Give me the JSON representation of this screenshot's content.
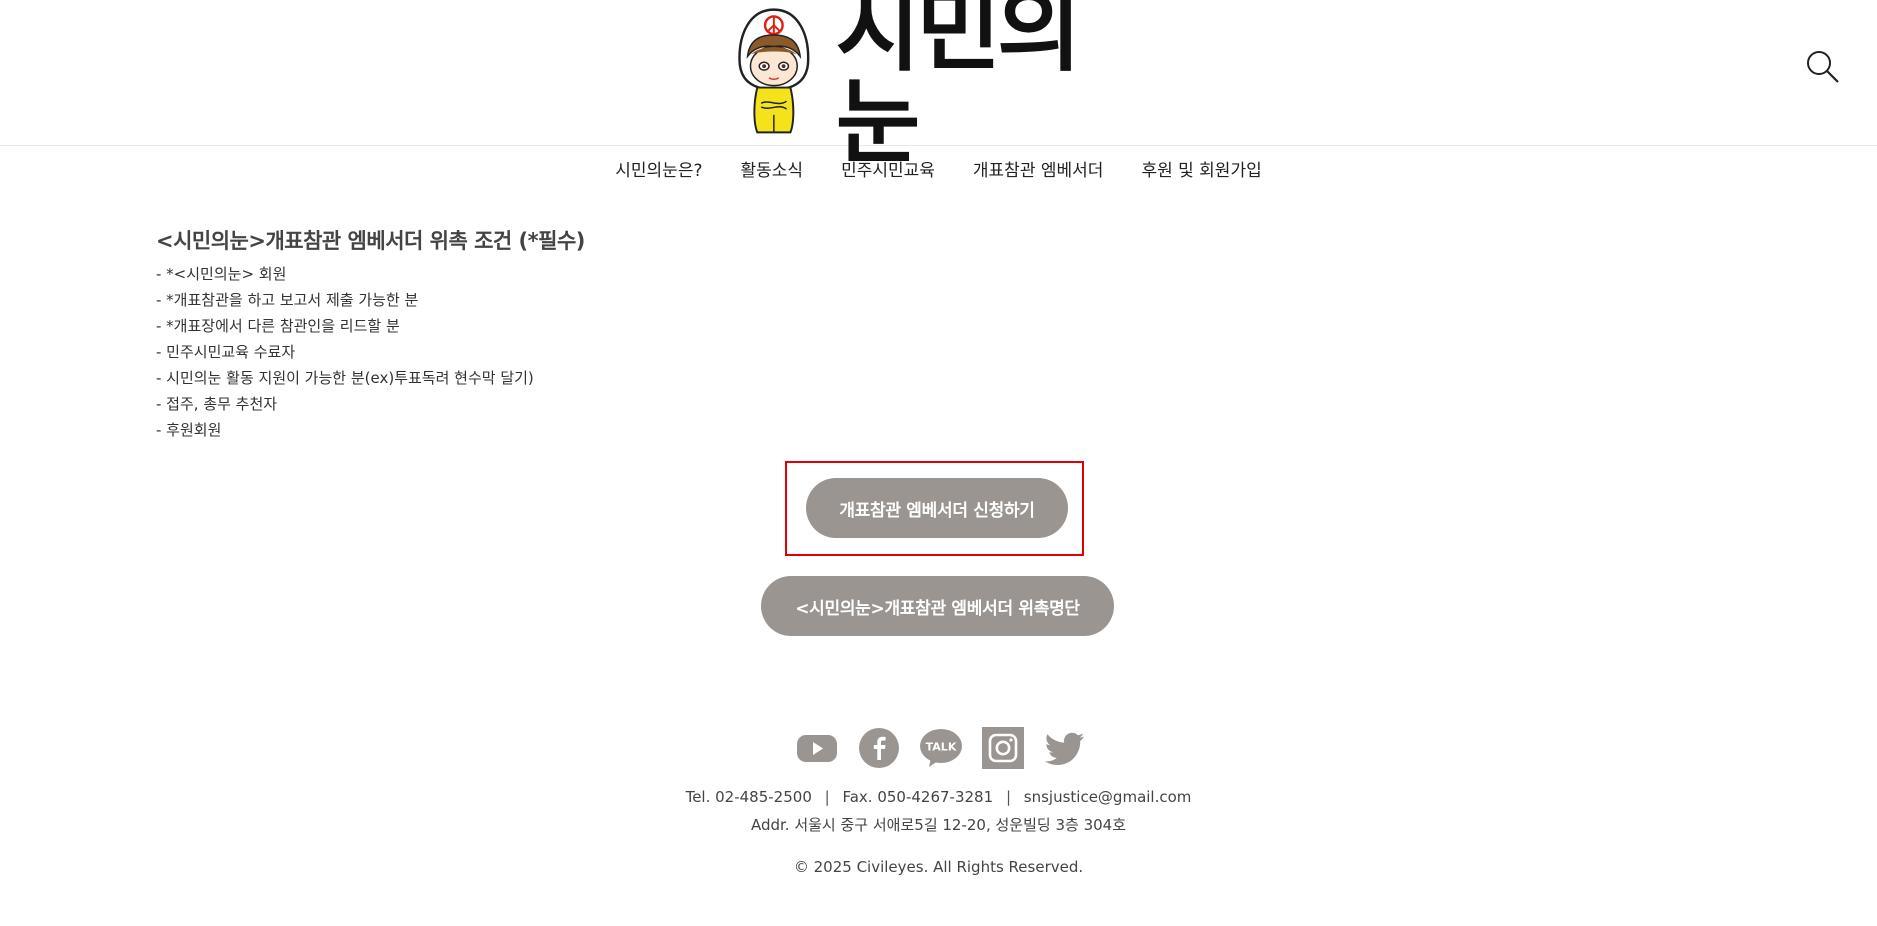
{
  "header": {
    "logo_text": "시민의눈"
  },
  "nav": {
    "items": [
      {
        "label": "시민의눈은?"
      },
      {
        "label": "활동소식"
      },
      {
        "label": "민주시민교육"
      },
      {
        "label": "개표참관 엠베서더"
      },
      {
        "label": "후원 및 회원가입"
      }
    ]
  },
  "content": {
    "title": "<시민의눈>개표참관 엠베서더 위촉 조건 (*필수)",
    "conditions": [
      "- *<시민의눈> 회원",
      "- *개표참관을 하고 보고서 제출 가능한 분",
      "- *개표장에서 다른 참관인을 리드할 분",
      "- 민주시민교육 수료자",
      "- 시민의눈 활동 지원이 가능한 분(ex)투표독려 현수막 달기)",
      "- 접주, 총무 추천자",
      "- 후원회원"
    ]
  },
  "buttons": {
    "apply_label": "개표참관 엠베서더 신청하기",
    "list_label": "<시민의눈>개표참관 엠베서더 위촉명단"
  },
  "footer": {
    "tel": "Tel. 02-485-2500",
    "fax": "Fax. 050-4267-3281",
    "email": "snsjustice@gmail.com",
    "sep": "|",
    "addr": "Addr. 서울시 중구 서애로5길 12-20, 성운빌딩 3층 304호",
    "copyright": "© 2025 Civileyes. All Rights Reserved.",
    "talk_text": "TALK"
  },
  "colors": {
    "button_bg": "#9a9590",
    "highlight_border": "#e30000",
    "icon_gray": "#9a9590"
  },
  "icons": [
    "search-icon",
    "youtube-icon",
    "facebook-icon",
    "kakaotalk-icon",
    "instagram-icon",
    "twitter-icon"
  ]
}
